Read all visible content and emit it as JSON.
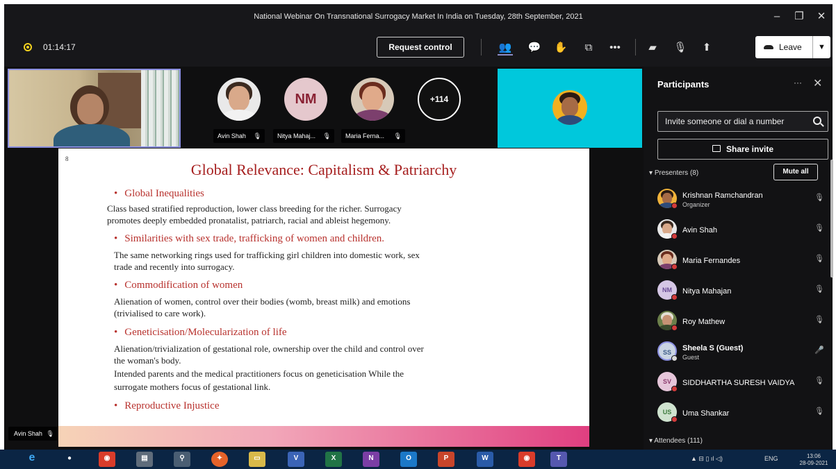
{
  "window": {
    "title": "National Webinar On Transnational Surrogacy Market In India on Tuesday, 28th September, 2021",
    "minimize_icon": "minimize-icon",
    "maximize_icon": "maximize-icon",
    "close_icon": "close-icon"
  },
  "toolbar": {
    "timer": "01:14:17",
    "request_control": "Request control",
    "icons": [
      "people-icon",
      "chat-icon",
      "reactions-icon",
      "rooms-icon",
      "more-icon",
      "camera-off-icon",
      "mic-off-icon",
      "share-icon"
    ],
    "leave_label": "Leave"
  },
  "stage": {
    "roster": [
      {
        "name": "Avin Shah",
        "muted": true
      },
      {
        "name": "Nitya Mahaj...",
        "initials": "NM",
        "muted": true
      },
      {
        "name": "Maria Ferna...",
        "muted": true
      }
    ],
    "overflow_count": "+114",
    "active_speaker": "Avin Shah",
    "colors": {
      "cyan_tile": "#00c8dc",
      "self_border": "#8a8ee0"
    }
  },
  "slide": {
    "corner": "8",
    "title": "Global Relevance: Capitalism & Patriarchy",
    "bullet": "•",
    "items": [
      {
        "heading": "Global Inequalities",
        "body": [
          "Class based stratified reproduction, lower class breeding for the richer. Surrogacy",
          "promotes deeply embedded pronatalist, patriarch, racial and ableist hegemony."
        ]
      },
      {
        "heading": "Similarities with sex trade, trafficking of women and children.",
        "body": [
          "The same networking rings used for trafficking girl children into domestic work, sex",
          "trade and recently into surrogacy."
        ]
      },
      {
        "heading": "Commodification of women",
        "body": [
          "Alienation of women, control over their bodies (womb, breast milk) and emotions",
          "(trivialised to care work)."
        ]
      },
      {
        "heading": "Geneticisation/Molecularization of life",
        "body": [
          "Alienation/trivialization of gestational role, ownership over the child and control over",
          "the woman's body.",
          "Intended parents and the medical practitioners focus on geneticisation While the",
          "surrogate mothers focus of gestational link."
        ]
      },
      {
        "heading": "Reproductive Injustice",
        "body": []
      }
    ],
    "colors": {
      "heading": "#b8322e",
      "title": "#a61f1f"
    }
  },
  "panel": {
    "title": "Participants",
    "invite_placeholder": "Invite someone or dial a number",
    "share_invite": "Share invite",
    "presenters_label": "Presenters (8)",
    "mute_all": "Mute all",
    "attendees_label": "Attendees (111)",
    "presenters": [
      {
        "name": "Krishnan Ramchandran",
        "role": "Organizer",
        "mic": "mic-off-icon"
      },
      {
        "name": "Avin Shah",
        "role": "",
        "mic": "mic-off-icon"
      },
      {
        "name": "Maria Fernandes",
        "role": "",
        "mic": "mic-off-icon"
      },
      {
        "name": "Nitya Mahajan",
        "role": "",
        "initials": "NM",
        "mic": "mic-off-icon"
      },
      {
        "name": "Roy Mathew",
        "role": "",
        "mic": "mic-off-icon"
      },
      {
        "name": "Sheela S (Guest)",
        "role": "Guest",
        "initials": "SS",
        "mic": "mic-on-icon"
      },
      {
        "name": "SIDDHARTHA SURESH VAIDYA",
        "role": "",
        "initials": "SV",
        "mic": "mic-off-icon"
      },
      {
        "name": "Uma Shankar",
        "role": "",
        "initials": "US",
        "mic": "mic-off-icon"
      }
    ]
  },
  "taskbar": {
    "apps": [
      "ie-icon",
      "user-icon",
      "chrome-icon",
      "file-icon",
      "search-person-icon",
      "firefox-icon",
      "explorer-icon",
      "visio-icon",
      "excel-icon",
      "onenote-icon",
      "outlook-icon",
      "powerpoint-icon",
      "word-icon",
      "chrome-icon",
      "teams-icon"
    ],
    "lang": "ENG",
    "time": "13:06",
    "date": "28-09-2021"
  }
}
